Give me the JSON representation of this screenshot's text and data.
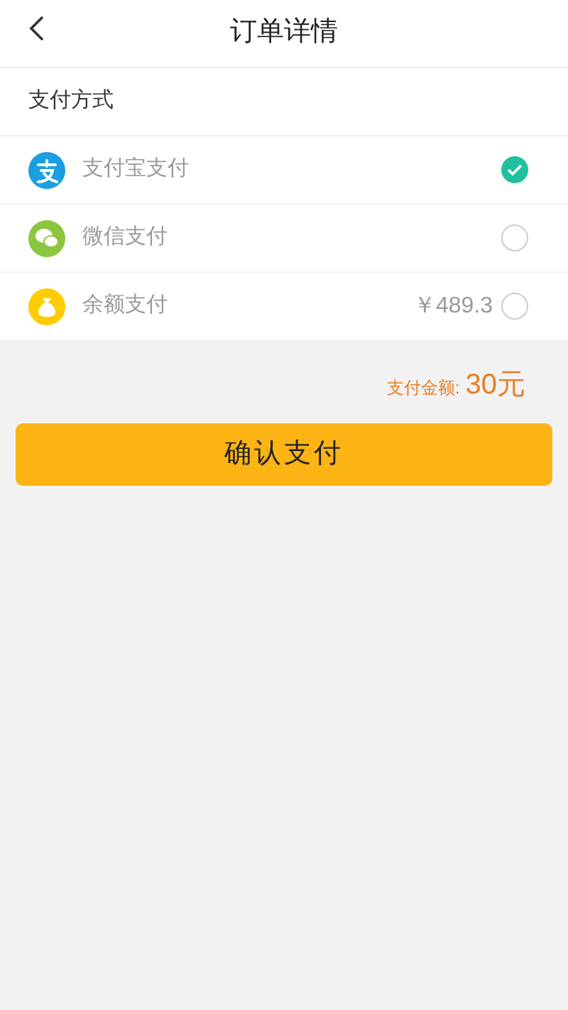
{
  "header": {
    "title": "订单详情"
  },
  "section_title": "支付方式",
  "methods": [
    {
      "kind": "alipay",
      "label": "支付宝支付",
      "selected": true
    },
    {
      "kind": "wechat",
      "label": "微信支付",
      "selected": false
    },
    {
      "kind": "balance",
      "label": "余额支付",
      "balance": "￥489.3",
      "selected": false
    }
  ],
  "amount": {
    "label": "支付金额:",
    "value": "30元"
  },
  "confirm_button": "确认支付"
}
